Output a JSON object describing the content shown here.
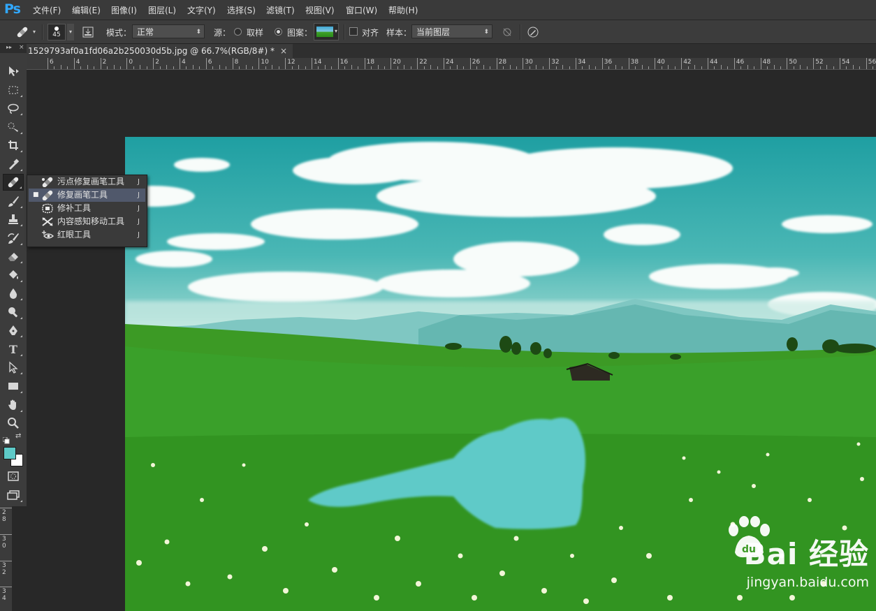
{
  "app": {
    "logo": "Ps"
  },
  "menu": [
    "文件(F)",
    "编辑(E)",
    "图像(I)",
    "图层(L)",
    "文字(Y)",
    "选择(S)",
    "滤镜(T)",
    "视图(V)",
    "窗口(W)",
    "帮助(H)"
  ],
  "options": {
    "brush_size": "45",
    "mode_label": "模式：",
    "mode_value": "正常",
    "source_label": "源：",
    "sampled_label": "取样",
    "pattern_label": "图案：",
    "aligned_label": "对齐",
    "sample_label": "样本：",
    "sample_value": "当前图层",
    "source_selected": "图案"
  },
  "document": {
    "tab_title": "1529793af0a1fd06a2b250030d5b.jpg @ 66.7%(RGB/8#) *",
    "close": "×"
  },
  "ruler": {
    "h_labels": [
      "6",
      "4",
      "2",
      "0",
      "2",
      "4",
      "6",
      "8",
      "10",
      "12",
      "14",
      "16",
      "18",
      "20",
      "22",
      "24",
      "26",
      "28",
      "30",
      "32",
      "34",
      "36",
      "38",
      "40",
      "42",
      "44",
      "46",
      "48",
      "50",
      "52",
      "54",
      "56"
    ],
    "v_labels": [
      "2\n8",
      "3\n0",
      "3\n2",
      "3\n4"
    ]
  },
  "toolbox": {
    "tools": [
      "move-tool",
      "marquee-tool",
      "lasso-tool",
      "quick-selection-tool",
      "crop-tool",
      "eyedropper-tool",
      "healing-brush-tool",
      "brush-tool",
      "clone-stamp-tool",
      "history-brush-tool",
      "eraser-tool",
      "paint-bucket-tool",
      "blur-tool",
      "dodge-tool",
      "pen-tool",
      "type-tool",
      "path-selection-tool",
      "rectangle-tool",
      "hand-tool",
      "zoom-tool"
    ],
    "type_tool_glyph": "T",
    "foreground_color": "#5ecac8",
    "background_color": "#ffffff"
  },
  "flyout": {
    "items": [
      {
        "label": "污点修复画笔工具",
        "key": "J",
        "selected": false
      },
      {
        "label": "修复画笔工具",
        "key": "J",
        "selected": true
      },
      {
        "label": "修补工具",
        "key": "J",
        "selected": false
      },
      {
        "label": "内容感知移动工具",
        "key": "J",
        "selected": false
      },
      {
        "label": "红眼工具",
        "key": "J",
        "selected": false
      }
    ]
  },
  "watermark": {
    "brand": "Bai 经验",
    "url": "jingyan.baidu.com"
  },
  "colors": {
    "accent": "#31a8ff",
    "sky": "#2aa9aa",
    "grass": "#3c9a25",
    "patch": "#5ecac8"
  }
}
